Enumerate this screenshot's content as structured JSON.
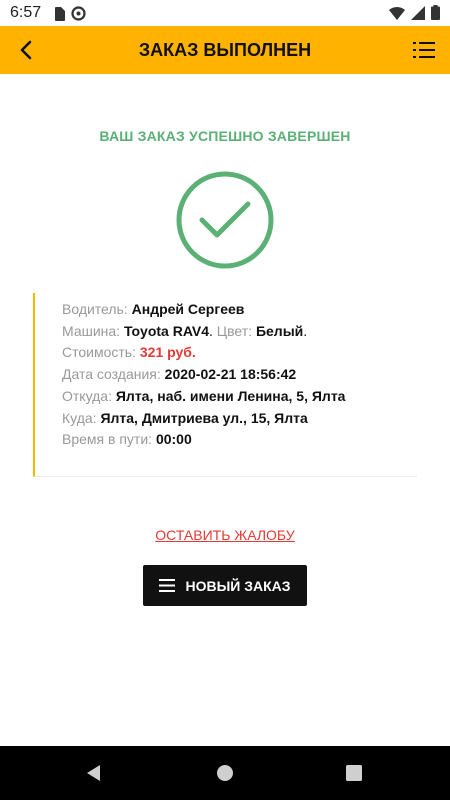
{
  "status_bar": {
    "time": "6:57",
    "icons": [
      "sim-card-icon",
      "media-icon",
      "wifi-icon",
      "signal-icon",
      "battery-icon"
    ]
  },
  "app_bar": {
    "title": "ЗАКАЗ ВЫПОЛНЕН",
    "back_icon": "back-arrow-icon",
    "menu_icon": "list-menu-icon",
    "background": "#FFB300"
  },
  "success": {
    "heading": "ВАШ ЗАКАЗ УСПЕШНО ЗАВЕРШЕН",
    "icon": "checkmark-circle-icon",
    "color": "#5BB075"
  },
  "details": {
    "driver_label": "Водитель:",
    "driver_value": "Андрей Сергеев",
    "car_label": "Машина:",
    "car_value": "Toyota RAV4",
    "color_sep": ".",
    "color_label": "Цвет:",
    "color_value": "Белый",
    "color_end": ".",
    "cost_label": "Стоимость:",
    "cost_value": "321 руб.",
    "created_label": "Дата создания:",
    "created_value": "2020-02-21 18:56:42",
    "from_label": "Откуда:",
    "from_value": "Ялта, наб. имени Ленина, 5, Ялта",
    "to_label": "Куда:",
    "to_value": "Ялта, Дмитриева ул., 15, Ялта",
    "duration_label": "Время в пути:",
    "duration_value": "00:00"
  },
  "actions": {
    "complaint_link": "ОСТАВИТЬ ЖАЛОБУ",
    "new_order_button": "НОВЫЙ ЗАКАЗ"
  },
  "nav_bar": {
    "icons": [
      "nav-back-icon",
      "nav-home-icon",
      "nav-recents-icon"
    ]
  }
}
